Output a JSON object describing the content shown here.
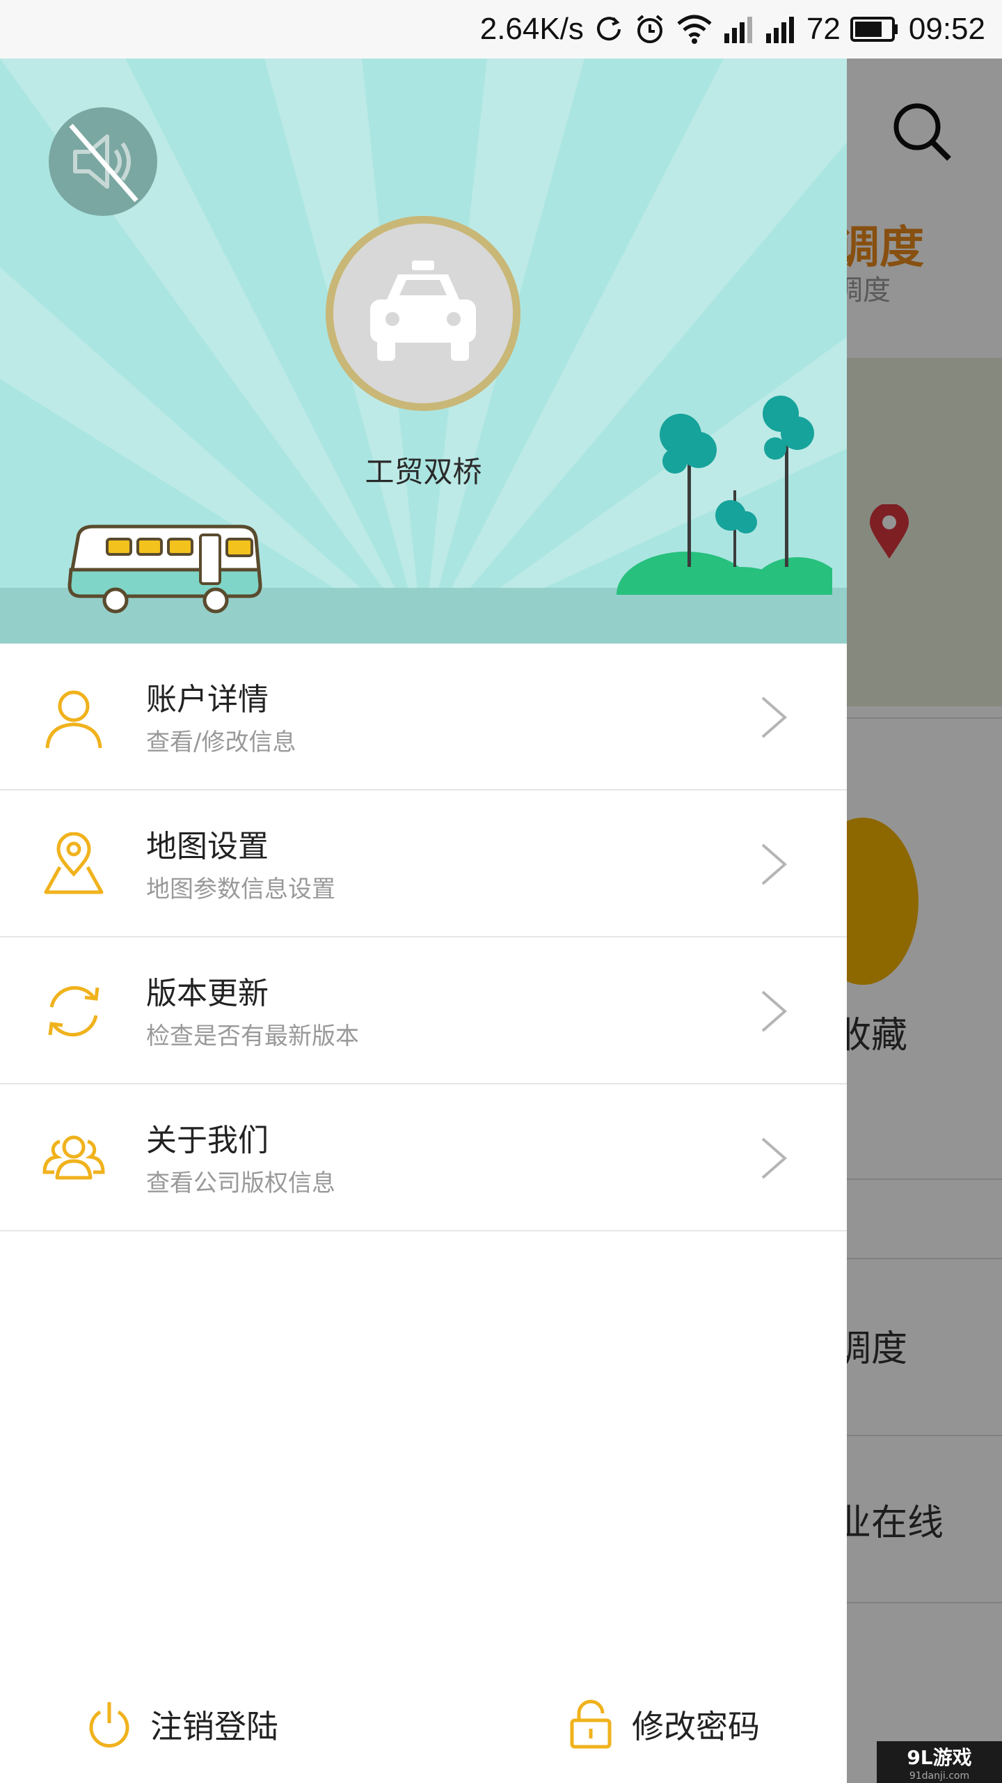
{
  "status_bar": {
    "speed": "2.64K/s",
    "battery": "72",
    "time": "09:52"
  },
  "background": {
    "title_partial": "调度",
    "subtitle_partial": "调度",
    "favorites_partial": "收藏",
    "item1_partial": "调度",
    "item2_partial": "业在线"
  },
  "drawer": {
    "username": "工贸双桥",
    "menu": [
      {
        "title": "账户详情",
        "desc": "查看/修改信息",
        "icon": "user-icon"
      },
      {
        "title": "地图设置",
        "desc": "地图参数信息设置",
        "icon": "map-pin-icon"
      },
      {
        "title": "版本更新",
        "desc": "检查是否有最新版本",
        "icon": "refresh-icon"
      },
      {
        "title": "关于我们",
        "desc": "查看公司版权信息",
        "icon": "team-icon"
      }
    ],
    "logout_label": "注销登陆",
    "change_password_label": "修改密码"
  },
  "watermark": {
    "brand": "9L游戏",
    "domain": "91danji.com"
  },
  "colors": {
    "accent": "#f0b21c",
    "header_bg": "#abe5e1",
    "ground": "#95cfca",
    "avatar_ring": "#c9b777"
  }
}
